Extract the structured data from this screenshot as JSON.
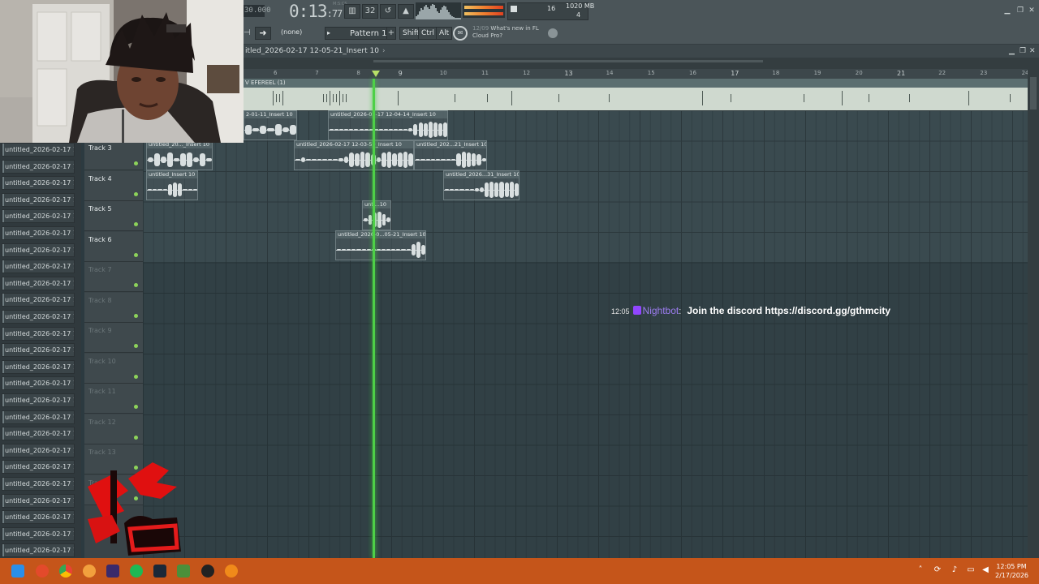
{
  "toolbar": {
    "tempo_partial": "30.000",
    "time": "0:13",
    "time_centis": "77",
    "time_label": "M:S:CS",
    "cpu_value": "16",
    "memory": "1020 MB",
    "voices": "4",
    "pattern_selector": "(none)",
    "pattern_label": "Pattern 1",
    "modifier_keys": [
      "Shift",
      "Ctrl",
      "Alt"
    ],
    "news_date": "12/09",
    "news_text_line1": "What's new in FL",
    "news_text_line2": "Cloud Pro?"
  },
  "playlist": {
    "title": "itled_2026-02-17 12-05-21_Insert 10",
    "ruler_labels": [
      "6",
      "7",
      "8",
      "9",
      "10",
      "11",
      "12",
      "13",
      "14",
      "15",
      "16",
      "17",
      "18",
      "19",
      "20",
      "21",
      "22",
      "23",
      "24"
    ],
    "master_track_label": "V EFEREEL (1)",
    "tracks": [
      {
        "name": "Track 3",
        "active": true
      },
      {
        "name": "Track 4",
        "active": true
      },
      {
        "name": "Track 5",
        "active": true
      },
      {
        "name": "Track 6",
        "active": true
      },
      {
        "name": "Track 7",
        "active": false
      },
      {
        "name": "Track 8",
        "active": false
      },
      {
        "name": "Track 9",
        "active": false
      },
      {
        "name": "Track 10",
        "active": false
      },
      {
        "name": "Track 11",
        "active": false
      },
      {
        "name": "Track 12",
        "active": false
      },
      {
        "name": "Track 13",
        "active": false
      },
      {
        "name": "Track 14",
        "active": false
      }
    ],
    "clips": [
      {
        "label": "2-01-11_Insert 10"
      },
      {
        "label": "untitled_2026-02-17 12-04-14_Insert 10"
      },
      {
        "label": "untitled_20..._Insert 10"
      },
      {
        "label": "untitled_2026-02-17 12-03-59_Insert 10"
      },
      {
        "label": "untitled_202...21_Insert 10"
      },
      {
        "label": "untitled_Insert 10"
      },
      {
        "label": "untitled_2026...31_Insert 10"
      },
      {
        "label": "unti...10"
      },
      {
        "label": "untitled_2026-0...05-21_Insert 10"
      }
    ]
  },
  "browser": {
    "items": [
      "untitled_2026-02-17 12-",
      "untitled_2026-02-17 12-",
      "untitled_2026-02-17 12-",
      "untitled_2026-02-17 12-",
      "untitled_2026-02-17 12-",
      "untitled_2026-02-17 12-",
      "untitled_2026-02-17 12-",
      "untitled_2026-02-17 12-",
      "untitled_2026-02-17 12-",
      "untitled_2026-02-17 12-",
      "untitled_2026-02-17 12-",
      "untitled_2026-02-17 12-",
      "untitled_2026-02-17 12-",
      "untitled_2026-02-17 12-",
      "untitled_2026-02-17 12-",
      "untitled_2026-02-17 12-",
      "untitled_2026-02-17 12-",
      "untitled_2026-02-17 12-",
      "untitled_2026-02-17 12-",
      "untitled_2026-02-17 12-",
      "untitled_2026-02-17 12-",
      "untitled_2026-02-17 12-",
      "untitled_2026-02-17 12-",
      "untitled_2026-02-17 12-",
      "untitled_2026-02-17 12-"
    ]
  },
  "chat": {
    "time": "12:05",
    "username": "Nightbot",
    "message": "Join the discord https://discord.gg/gthmcity"
  },
  "taskbar": {
    "clock_time": "12:05 PM",
    "clock_date": "2/17/2026",
    "colors": {
      "bar": "#c5551a",
      "accent_green": "#4ed047"
    }
  }
}
